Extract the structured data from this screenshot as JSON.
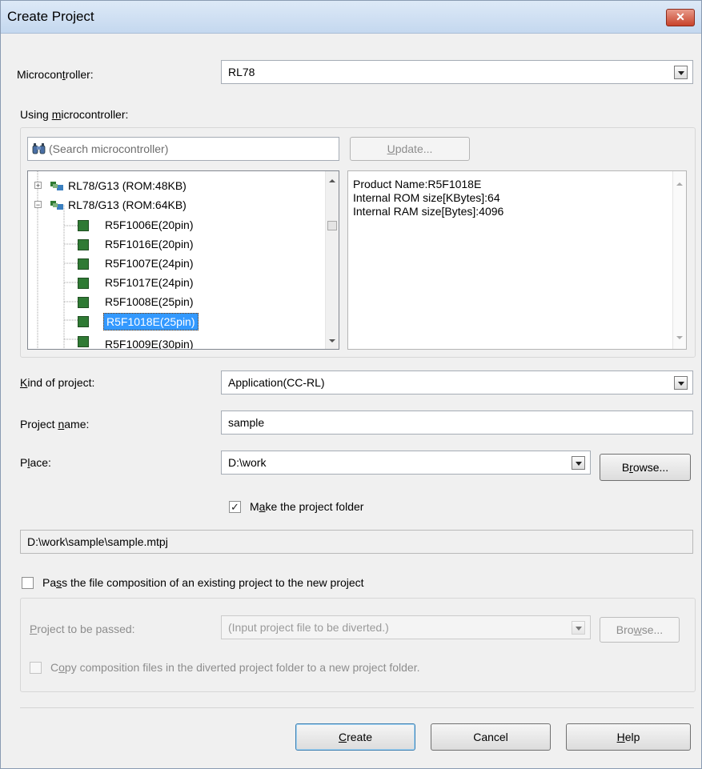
{
  "window": {
    "title": "Create Project",
    "close_glyph": "✕"
  },
  "microcontroller": {
    "label_pre": "Microcon",
    "label_u": "t",
    "label_post": "roller:",
    "value": "RL78"
  },
  "using": {
    "label_pre": "Using ",
    "label_u": "m",
    "label_post": "icrocontroller:"
  },
  "search": {
    "placeholder": "(Search microcontroller)",
    "icon": "binoculars-icon"
  },
  "update_button": {
    "label_u": "U",
    "label_post": "pdate..."
  },
  "tree": {
    "items": [
      {
        "label": "RL78/G13 (ROM:48KB)",
        "type": "group",
        "expanded": false
      },
      {
        "label": "RL78/G13 (ROM:64KB)",
        "type": "group",
        "expanded": true
      },
      {
        "label": "R5F1006E(20pin)",
        "type": "device",
        "selected": false
      },
      {
        "label": "R5F1016E(20pin)",
        "type": "device",
        "selected": false
      },
      {
        "label": "R5F1007E(24pin)",
        "type": "device",
        "selected": false
      },
      {
        "label": "R5F1017E(24pin)",
        "type": "device",
        "selected": false
      },
      {
        "label": "R5F1008E(25pin)",
        "type": "device",
        "selected": false
      },
      {
        "label": "R5F1018E(25pin)",
        "type": "device",
        "selected": true
      },
      {
        "label": "R5F1009E(30pin)",
        "type": "device",
        "selected": false
      }
    ]
  },
  "info": {
    "lines": [
      "Product Name:R5F1018E",
      "Internal ROM size[KBytes]:64",
      "Internal RAM size[Bytes]:4096"
    ]
  },
  "kind": {
    "label_u": "K",
    "label_post": "ind of project:",
    "value": "Application(CC-RL)"
  },
  "project_name": {
    "label_pre": "Project ",
    "label_u": "n",
    "label_post": "ame:",
    "value": "sample"
  },
  "place": {
    "label_pre": "P",
    "label_u": "l",
    "label_post": "ace:",
    "value": "D:\\work"
  },
  "browse_button": {
    "label_pre": "B",
    "label_u": "r",
    "label_post": "owse..."
  },
  "make_folder": {
    "checked": "✓",
    "label_pre": "M",
    "label_u": "a",
    "label_post": "ke the project folder"
  },
  "path_display": {
    "value": "D:\\work\\sample\\sample.mtpj"
  },
  "pass_composition": {
    "label_pre": "Pa",
    "label_u": "s",
    "label_post": "s the file composition of an existing project to the new project"
  },
  "project_to_pass": {
    "label_u": "P",
    "label_post": "roject to be passed:",
    "placeholder": "(Input project file to be diverted.)"
  },
  "browse2_button": {
    "label_pre": "Bro",
    "label_u": "w",
    "label_post": "se..."
  },
  "copy_files": {
    "label_pre": "C",
    "label_u": "o",
    "label_post": "py composition files in the diverted project folder to a new project folder."
  },
  "buttons": {
    "create": {
      "label_u": "C",
      "label_post": "reate"
    },
    "cancel": {
      "label": "Cancel"
    },
    "help": {
      "label_u": "H",
      "label_post": "elp"
    }
  }
}
